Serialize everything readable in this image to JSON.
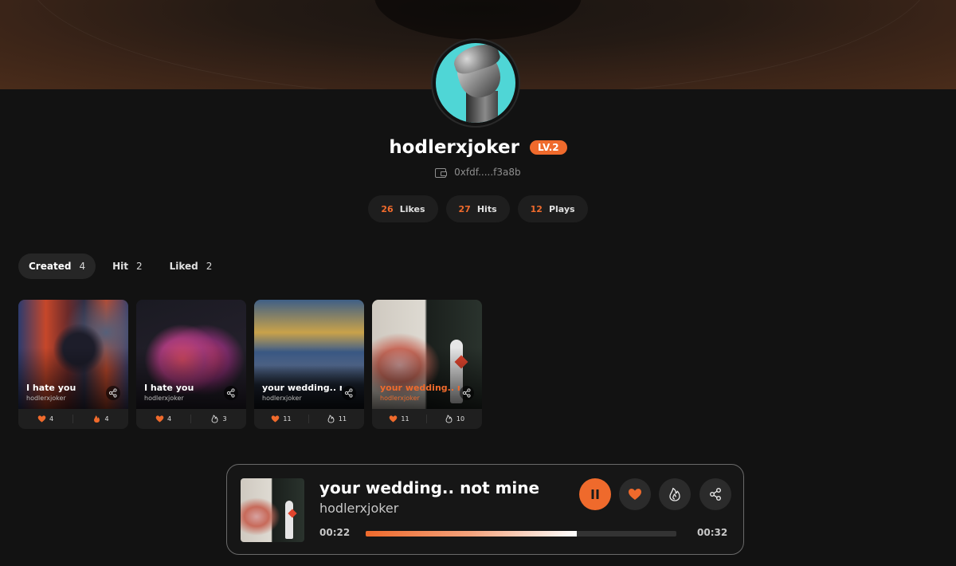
{
  "profile": {
    "username": "hodlerxjoker",
    "level": "LV.2",
    "wallet": "0xfdf.....f3a8b"
  },
  "stats": [
    {
      "value": "26",
      "label": "Likes"
    },
    {
      "value": "27",
      "label": "Hits"
    },
    {
      "value": "12",
      "label": "Plays"
    }
  ],
  "tabs": [
    {
      "label": "Created",
      "count": "4",
      "active": true
    },
    {
      "label": "Hit",
      "count": "2",
      "active": false
    },
    {
      "label": "Liked",
      "count": "2",
      "active": false
    }
  ],
  "cards": [
    {
      "title": "I hate you",
      "author": "hodlerxjoker",
      "likes": "4",
      "hits": "4",
      "playing": false
    },
    {
      "title": "I hate you",
      "author": "hodlerxjoker",
      "likes": "4",
      "hits": "3",
      "playing": false
    },
    {
      "title": "your wedding.. not mine",
      "author": "hodlerxjoker",
      "likes": "11",
      "hits": "11",
      "playing": false
    },
    {
      "title": "your wedding.. not mine",
      "author": "hodlerxjoker",
      "likes": "11",
      "hits": "10",
      "playing": true
    }
  ],
  "player": {
    "title": "your wedding.. not mine",
    "artist": "hodlerxjoker",
    "current_time": "00:22",
    "duration": "00:32",
    "progress_fraction": 0.68
  },
  "colors": {
    "accent": "#ef6a2c",
    "background": "#121212"
  },
  "icons": {
    "wallet": "wallet-icon",
    "share": "share-icon",
    "heart": "heart-icon",
    "flame": "flame-icon",
    "pause": "pause-icon"
  }
}
